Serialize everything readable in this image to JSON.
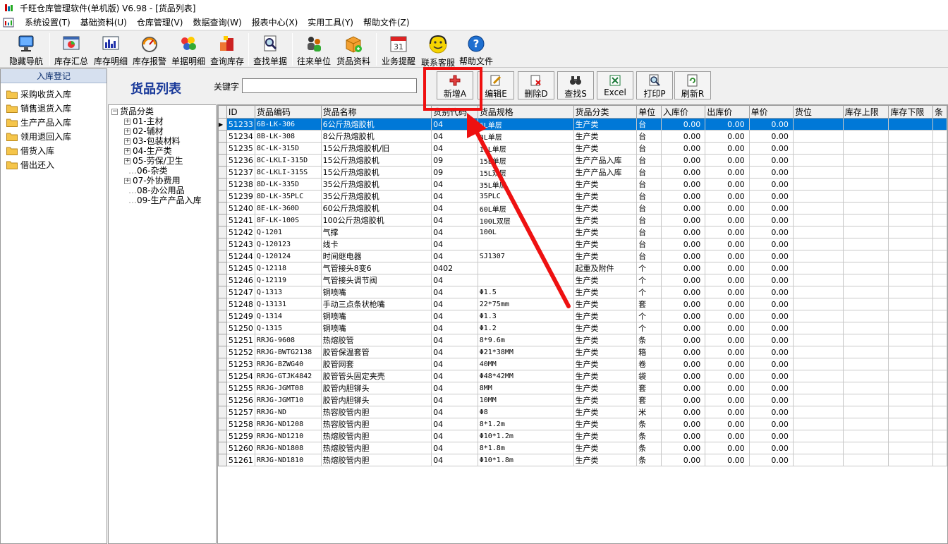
{
  "window": {
    "title": "千旺仓库管理软件(单机版) V6.98 - [货品列表]"
  },
  "menu": [
    "系统设置(T)",
    "基础资料(U)",
    "仓库管理(V)",
    "数据查询(W)",
    "报表中心(X)",
    "实用工具(Y)",
    "帮助文件(Z)"
  ],
  "toolbar": {
    "hide_nav": "隐藏导航",
    "stock_summary": "库存汇总",
    "stock_detail": "库存明细",
    "stock_alert": "库存报警",
    "doc_detail": "单据明细",
    "query_stock": "查询库存",
    "find_doc": "查找单据",
    "partners": "往来单位",
    "goods_info": "货品资料",
    "reminder": "业务提醒",
    "support": "联系客服",
    "help": "帮助文件",
    "calendar_day": "31"
  },
  "left_panel": {
    "header": "入库登记",
    "items": [
      "采购收货入库",
      "销售退货入库",
      "生产产品入库",
      "领用退回入库",
      "借货入库",
      "借出还入"
    ]
  },
  "header": {
    "title": "货品列表",
    "keyword_label": "关键字",
    "keyword_value": ""
  },
  "actions": {
    "add": "新增A",
    "edit": "编辑E",
    "delete": "删除D",
    "find": "查找S",
    "excel": "Excel",
    "print": "打印P",
    "refresh": "刷新R"
  },
  "tree": {
    "root": "货品分类",
    "nodes": [
      "01-主材",
      "02-辅材",
      "03-包装材料",
      "04-生产类",
      "05-劳保/卫生",
      "06-杂类",
      "07-外协费用",
      "08-办公用品",
      "09-生产产品入库"
    ]
  },
  "grid": {
    "columns": [
      "ID",
      "货品编码",
      "货品名称",
      "货别代码",
      "货品规格",
      "货品分类",
      "单位",
      "入库价",
      "出库价",
      "单价",
      "货位",
      "库存上限",
      "库存下限",
      "条"
    ],
    "selected_row": 0,
    "rows": [
      [
        "51233",
        "6B-LK-306",
        "6公斤热熔胶机",
        "04",
        "6L单层",
        "生产类",
        "台",
        "0.00",
        "0.00",
        "0.00"
      ],
      [
        "51234",
        "8B-LK-308",
        "8公斤热熔胶机",
        "04",
        "8L单层",
        "生产类",
        "台",
        "0.00",
        "0.00",
        "0.00"
      ],
      [
        "51235",
        "8C-LK-315D",
        "15公斤热熔胶机/旧",
        "04",
        "15L单层",
        "生产类",
        "台",
        "0.00",
        "0.00",
        "0.00"
      ],
      [
        "51236",
        "8C-LKLI-315D",
        "15公斤热熔胶机",
        "09",
        "15L单层",
        "生产产品入库",
        "台",
        "0.00",
        "0.00",
        "0.00"
      ],
      [
        "51237",
        "8C-LKLI-315S",
        "15公斤热熔胶机",
        "09",
        "15L双层",
        "生产产品入库",
        "台",
        "0.00",
        "0.00",
        "0.00"
      ],
      [
        "51238",
        "8D-LK-335D",
        "35公斤热熔胶机",
        "04",
        "35L单层",
        "生产类",
        "台",
        "0.00",
        "0.00",
        "0.00"
      ],
      [
        "51239",
        "8D-LK-35PLC",
        "35公斤热熔胶机",
        "04",
        "35PLC",
        "生产类",
        "台",
        "0.00",
        "0.00",
        "0.00"
      ],
      [
        "51240",
        "8E-LK-360D",
        "60公斤热熔胶机",
        "04",
        "60L单层",
        "生产类",
        "台",
        "0.00",
        "0.00",
        "0.00"
      ],
      [
        "51241",
        "8F-LK-100S",
        "100公斤热熔胶机",
        "04",
        "100L双层",
        "生产类",
        "台",
        "0.00",
        "0.00",
        "0.00"
      ],
      [
        "51242",
        "Q-1201",
        "气撑",
        "04",
        "100L",
        "生产类",
        "台",
        "0.00",
        "0.00",
        "0.00"
      ],
      [
        "51243",
        "Q-120123",
        "线卡",
        "04",
        "",
        "生产类",
        "台",
        "0.00",
        "0.00",
        "0.00"
      ],
      [
        "51244",
        "Q-120124",
        "时间继电器",
        "04",
        "SJ1307",
        "生产类",
        "台",
        "0.00",
        "0.00",
        "0.00"
      ],
      [
        "51245",
        "Q-12118",
        "气管接头8变6",
        "0402",
        "",
        "起重及附件",
        "个",
        "0.00",
        "0.00",
        "0.00"
      ],
      [
        "51246",
        "Q-12119",
        "气管接头调节阀",
        "04",
        "",
        "生产类",
        "个",
        "0.00",
        "0.00",
        "0.00"
      ],
      [
        "51247",
        "Q-1313",
        "铜喷嘴",
        "04",
        "Φ1.5",
        "生产类",
        "个",
        "0.00",
        "0.00",
        "0.00"
      ],
      [
        "51248",
        "Q-13131",
        "手动三点条状枪嘴",
        "04",
        "22*75mm",
        "生产类",
        "套",
        "0.00",
        "0.00",
        "0.00"
      ],
      [
        "51249",
        "Q-1314",
        "铜喷嘴",
        "04",
        "Φ1.3",
        "生产类",
        "个",
        "0.00",
        "0.00",
        "0.00"
      ],
      [
        "51250",
        "Q-1315",
        "铜喷嘴",
        "04",
        "Φ1.2",
        "生产类",
        "个",
        "0.00",
        "0.00",
        "0.00"
      ],
      [
        "51251",
        "RRJG-9608",
        "热熔胶管",
        "04",
        "8*9.6m",
        "生产类",
        "条",
        "0.00",
        "0.00",
        "0.00"
      ],
      [
        "51252",
        "RRJG-BWTG2138",
        "胶管保温套管",
        "04",
        "Φ21*38MM",
        "生产类",
        "箱",
        "0.00",
        "0.00",
        "0.00"
      ],
      [
        "51253",
        "RRJG-BZWG40",
        "胶管网套",
        "04",
        "40MM",
        "生产类",
        "卷",
        "0.00",
        "0.00",
        "0.00"
      ],
      [
        "51254",
        "RRJG-GTJK4842",
        "胶管管头固定夹壳",
        "04",
        "Φ48*42MM",
        "生产类",
        "袋",
        "0.00",
        "0.00",
        "0.00"
      ],
      [
        "51255",
        "RRJG-JGMT08",
        "胶管内胆铆头",
        "04",
        "8MM",
        "生产类",
        "套",
        "0.00",
        "0.00",
        "0.00"
      ],
      [
        "51256",
        "RRJG-JGMT10",
        "胶管内胆铆头",
        "04",
        "10MM",
        "生产类",
        "套",
        "0.00",
        "0.00",
        "0.00"
      ],
      [
        "51257",
        "RRJG-ND",
        "热容胶管内胆",
        "04",
        "Φ8",
        "生产类",
        "米",
        "0.00",
        "0.00",
        "0.00"
      ],
      [
        "51258",
        "RRJG-ND1208",
        "热容胶管内胆",
        "04",
        "8*1.2m",
        "生产类",
        "条",
        "0.00",
        "0.00",
        "0.00"
      ],
      [
        "51259",
        "RRJG-ND1210",
        "热熔胶管内胆",
        "04",
        "Φ10*1.2m",
        "生产类",
        "条",
        "0.00",
        "0.00",
        "0.00"
      ],
      [
        "51260",
        "RRJG-ND1808",
        "热熔胶管内胆",
        "04",
        "8*1.8m",
        "生产类",
        "条",
        "0.00",
        "0.00",
        "0.00"
      ],
      [
        "51261",
        "RRJG-ND1810",
        "热熔胶管内胆",
        "04",
        "Φ10*1.8m",
        "生产类",
        "条",
        "0.00",
        "0.00",
        "0.00"
      ]
    ]
  },
  "colors": {
    "selection": "#0078d7",
    "highlight": "#ef1010",
    "title_blue": "#1a3a9a"
  }
}
